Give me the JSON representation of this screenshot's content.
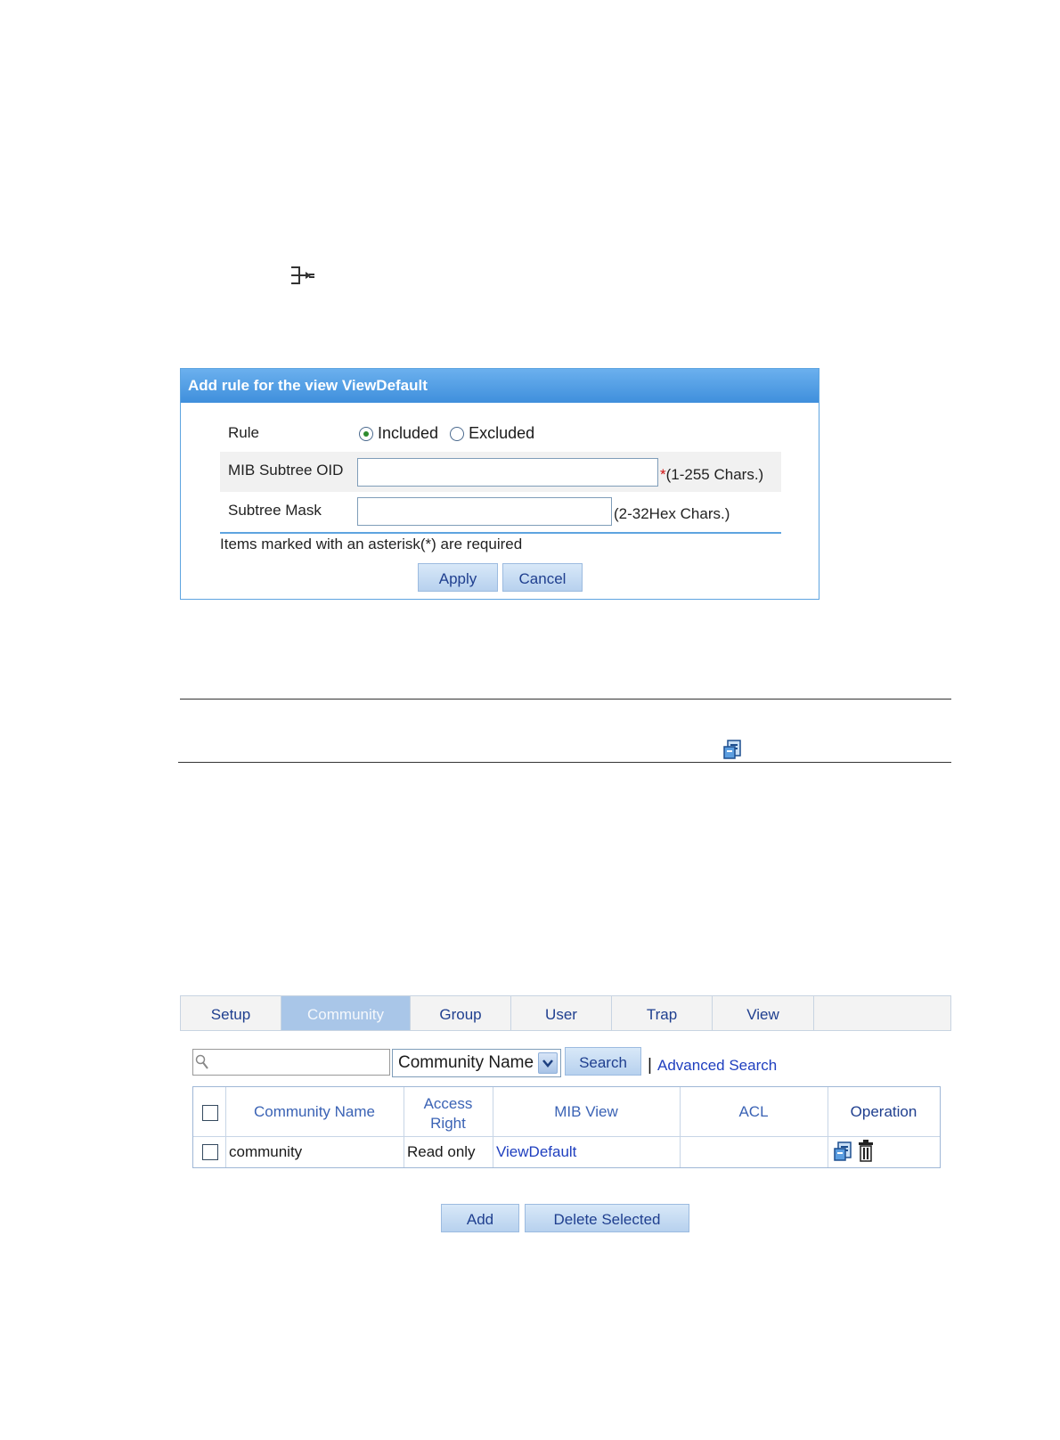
{
  "dialog": {
    "title": "Add rule for the view ViewDefault",
    "rule_label": "Rule",
    "included_label": "Included",
    "excluded_label": "Excluded",
    "selected_rule": "Included",
    "oid_label": "MIB Subtree OID",
    "oid_value": "",
    "oid_hint": "(1-255 Chars.)",
    "required_mark": "*",
    "mask_label": "Subtree Mask",
    "mask_value": "",
    "mask_hint": "(2-32Hex Chars.)",
    "required_note": "Items marked with an asterisk(*) are required",
    "apply_label": "Apply",
    "cancel_label": "Cancel"
  },
  "tabs": [
    {
      "label": "Setup"
    },
    {
      "label": "Community",
      "active": true
    },
    {
      "label": "Group"
    },
    {
      "label": "User"
    },
    {
      "label": "Trap"
    },
    {
      "label": "View"
    }
  ],
  "search": {
    "value": "",
    "field_selected": "Community Name",
    "search_label": "Search",
    "separator": "|",
    "advanced_label": "Advanced Search"
  },
  "table": {
    "headers": {
      "community_name": "Community Name",
      "access_right_1": "Access",
      "access_right_2": "Right",
      "mib_view": "MIB View",
      "acl": "ACL",
      "operation": "Operation"
    },
    "rows": [
      {
        "community_name": "community",
        "access_right": "Read only",
        "mib_view": "ViewDefault",
        "acl": ""
      }
    ]
  },
  "actions": {
    "add_label": "Add",
    "delete_label": "Delete Selected"
  },
  "colors": {
    "title_bar": "#3f8fdc",
    "active_tab": "#a9c6e8",
    "link": "#1f3fbf",
    "required": "#d01010"
  }
}
